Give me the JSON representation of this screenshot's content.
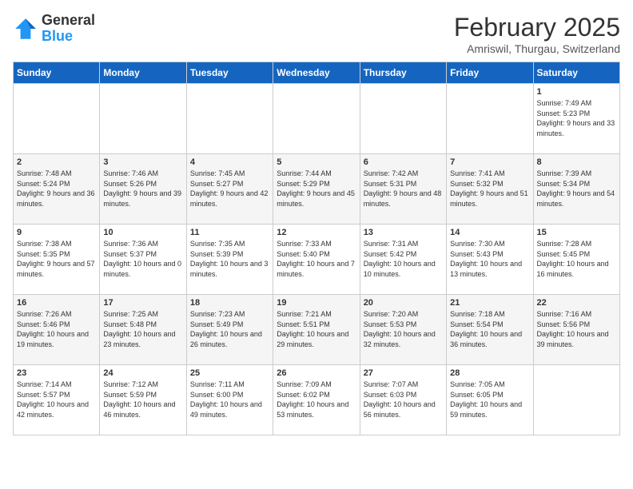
{
  "header": {
    "logo_general": "General",
    "logo_blue": "Blue",
    "month_title": "February 2025",
    "location": "Amriswil, Thurgau, Switzerland"
  },
  "columns": [
    "Sunday",
    "Monday",
    "Tuesday",
    "Wednesday",
    "Thursday",
    "Friday",
    "Saturday"
  ],
  "weeks": [
    [
      {
        "day": "",
        "info": ""
      },
      {
        "day": "",
        "info": ""
      },
      {
        "day": "",
        "info": ""
      },
      {
        "day": "",
        "info": ""
      },
      {
        "day": "",
        "info": ""
      },
      {
        "day": "",
        "info": ""
      },
      {
        "day": "1",
        "info": "Sunrise: 7:49 AM\nSunset: 5:23 PM\nDaylight: 9 hours and 33 minutes."
      }
    ],
    [
      {
        "day": "2",
        "info": "Sunrise: 7:48 AM\nSunset: 5:24 PM\nDaylight: 9 hours and 36 minutes."
      },
      {
        "day": "3",
        "info": "Sunrise: 7:46 AM\nSunset: 5:26 PM\nDaylight: 9 hours and 39 minutes."
      },
      {
        "day": "4",
        "info": "Sunrise: 7:45 AM\nSunset: 5:27 PM\nDaylight: 9 hours and 42 minutes."
      },
      {
        "day": "5",
        "info": "Sunrise: 7:44 AM\nSunset: 5:29 PM\nDaylight: 9 hours and 45 minutes."
      },
      {
        "day": "6",
        "info": "Sunrise: 7:42 AM\nSunset: 5:31 PM\nDaylight: 9 hours and 48 minutes."
      },
      {
        "day": "7",
        "info": "Sunrise: 7:41 AM\nSunset: 5:32 PM\nDaylight: 9 hours and 51 minutes."
      },
      {
        "day": "8",
        "info": "Sunrise: 7:39 AM\nSunset: 5:34 PM\nDaylight: 9 hours and 54 minutes."
      }
    ],
    [
      {
        "day": "9",
        "info": "Sunrise: 7:38 AM\nSunset: 5:35 PM\nDaylight: 9 hours and 57 minutes."
      },
      {
        "day": "10",
        "info": "Sunrise: 7:36 AM\nSunset: 5:37 PM\nDaylight: 10 hours and 0 minutes."
      },
      {
        "day": "11",
        "info": "Sunrise: 7:35 AM\nSunset: 5:39 PM\nDaylight: 10 hours and 3 minutes."
      },
      {
        "day": "12",
        "info": "Sunrise: 7:33 AM\nSunset: 5:40 PM\nDaylight: 10 hours and 7 minutes."
      },
      {
        "day": "13",
        "info": "Sunrise: 7:31 AM\nSunset: 5:42 PM\nDaylight: 10 hours and 10 minutes."
      },
      {
        "day": "14",
        "info": "Sunrise: 7:30 AM\nSunset: 5:43 PM\nDaylight: 10 hours and 13 minutes."
      },
      {
        "day": "15",
        "info": "Sunrise: 7:28 AM\nSunset: 5:45 PM\nDaylight: 10 hours and 16 minutes."
      }
    ],
    [
      {
        "day": "16",
        "info": "Sunrise: 7:26 AM\nSunset: 5:46 PM\nDaylight: 10 hours and 19 minutes."
      },
      {
        "day": "17",
        "info": "Sunrise: 7:25 AM\nSunset: 5:48 PM\nDaylight: 10 hours and 23 minutes."
      },
      {
        "day": "18",
        "info": "Sunrise: 7:23 AM\nSunset: 5:49 PM\nDaylight: 10 hours and 26 minutes."
      },
      {
        "day": "19",
        "info": "Sunrise: 7:21 AM\nSunset: 5:51 PM\nDaylight: 10 hours and 29 minutes."
      },
      {
        "day": "20",
        "info": "Sunrise: 7:20 AM\nSunset: 5:53 PM\nDaylight: 10 hours and 32 minutes."
      },
      {
        "day": "21",
        "info": "Sunrise: 7:18 AM\nSunset: 5:54 PM\nDaylight: 10 hours and 36 minutes."
      },
      {
        "day": "22",
        "info": "Sunrise: 7:16 AM\nSunset: 5:56 PM\nDaylight: 10 hours and 39 minutes."
      }
    ],
    [
      {
        "day": "23",
        "info": "Sunrise: 7:14 AM\nSunset: 5:57 PM\nDaylight: 10 hours and 42 minutes."
      },
      {
        "day": "24",
        "info": "Sunrise: 7:12 AM\nSunset: 5:59 PM\nDaylight: 10 hours and 46 minutes."
      },
      {
        "day": "25",
        "info": "Sunrise: 7:11 AM\nSunset: 6:00 PM\nDaylight: 10 hours and 49 minutes."
      },
      {
        "day": "26",
        "info": "Sunrise: 7:09 AM\nSunset: 6:02 PM\nDaylight: 10 hours and 53 minutes."
      },
      {
        "day": "27",
        "info": "Sunrise: 7:07 AM\nSunset: 6:03 PM\nDaylight: 10 hours and 56 minutes."
      },
      {
        "day": "28",
        "info": "Sunrise: 7:05 AM\nSunset: 6:05 PM\nDaylight: 10 hours and 59 minutes."
      },
      {
        "day": "",
        "info": ""
      }
    ]
  ]
}
